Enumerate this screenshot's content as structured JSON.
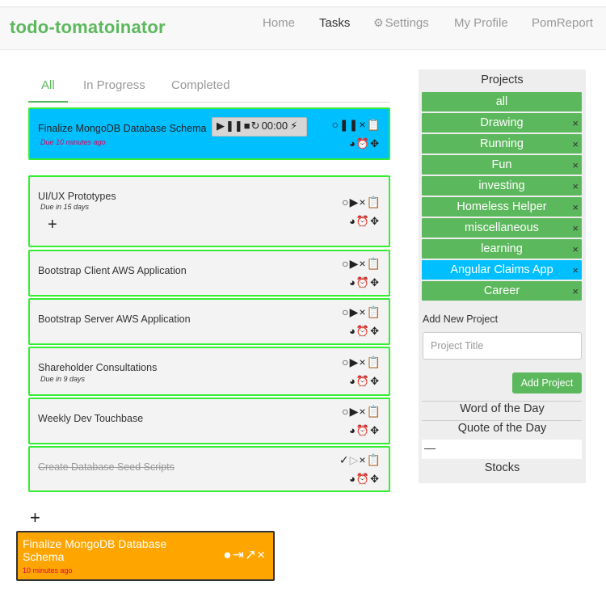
{
  "navbar": {
    "brand": "todo-tomatoinator",
    "links": [
      {
        "label": "Home",
        "active": false
      },
      {
        "label": "Tasks",
        "active": true
      },
      {
        "label": "Settings",
        "active": false
      },
      {
        "label": "My Profile",
        "active": false
      },
      {
        "label": "PomReport",
        "active": false
      }
    ]
  },
  "tabs": [
    {
      "label": "All",
      "active": true
    },
    {
      "label": "In Progress",
      "active": false
    },
    {
      "label": "Completed",
      "active": false
    }
  ],
  "tasks": [
    {
      "title": "Finalize MongoDB Database Schema",
      "due": "Due 10 minutes ago",
      "selected": true,
      "running": true,
      "timer": "00:00"
    },
    {
      "title": "UI/UX Prototypes",
      "due": "Due in 15 days"
    },
    {
      "title": "Bootstrap Client AWS Application",
      "due": ""
    },
    {
      "title": "Bootstrap Server AWS Application",
      "due": ""
    },
    {
      "title": "Shareholder Consultations",
      "due": "Due in 9 days"
    },
    {
      "title": "Weekly Dev Touchbase",
      "due": ""
    },
    {
      "title": "Create Database Seed Scripts",
      "due": "",
      "completed": true
    }
  ],
  "notification": {
    "title": "Finalize MongoDB Database Schema",
    "time": "10 minutes ago",
    "color": "#ffa500"
  },
  "sidebar": {
    "projects_heading": "Projects",
    "projects": [
      {
        "label": "all",
        "removable": false
      },
      {
        "label": "Drawing",
        "removable": true
      },
      {
        "label": "Running",
        "removable": true
      },
      {
        "label": "Fun",
        "removable": true
      },
      {
        "label": "investing",
        "removable": true
      },
      {
        "label": "Homeless Helper",
        "removable": true
      },
      {
        "label": "miscellaneous",
        "removable": true
      },
      {
        "label": "learning",
        "removable": true
      },
      {
        "label": "Angular Claims App",
        "removable": true,
        "selected": true
      },
      {
        "label": "Career",
        "removable": true
      }
    ],
    "remove_symbol": "×",
    "add_project_label": "Add New Project",
    "project_title_placeholder": "Project Title",
    "add_project_button": "Add Project",
    "word_of_day": "Word of the Day",
    "quote_of_day": "Quote of the Day",
    "quote_value": "—",
    "stocks": "Stocks"
  },
  "colors": {
    "brand_green": "#5cb85c",
    "selected_blue": "#00bfff",
    "task_border": "#33ee33",
    "due_overdue": "#e0005a"
  }
}
